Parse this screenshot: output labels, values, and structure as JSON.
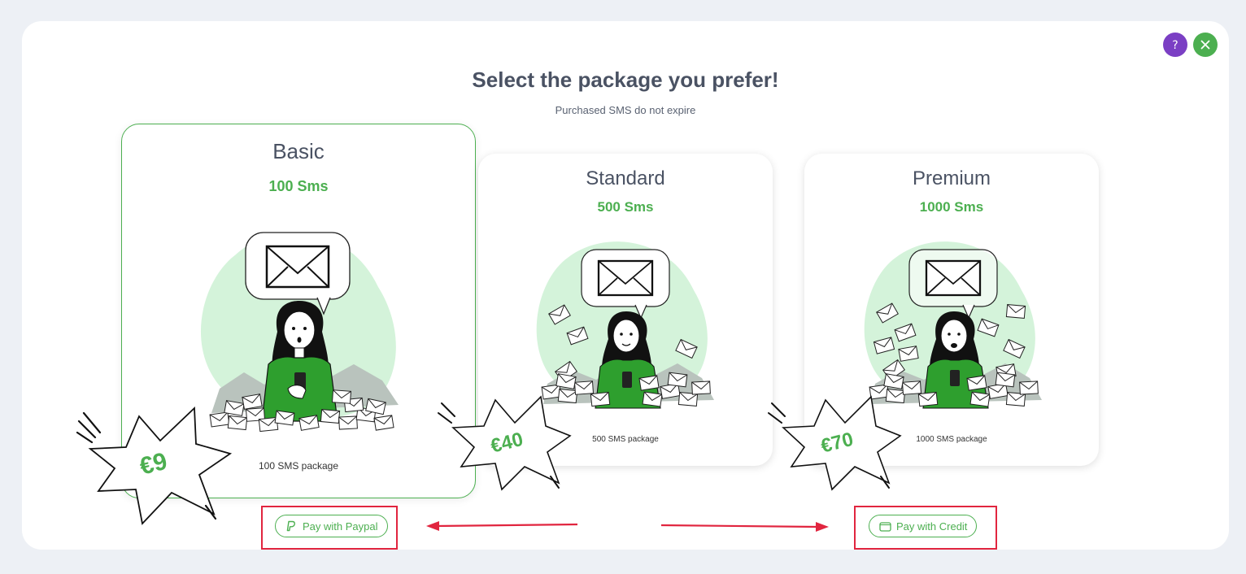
{
  "header": {
    "title": "Select the package you prefer!",
    "subtitle": "Purchased SMS do not expire",
    "help_icon": "question-icon",
    "close_icon": "close-icon"
  },
  "packages": [
    {
      "name": "Basic",
      "sms": "100 Sms",
      "caption": "100 SMS package",
      "price": "€9",
      "selected": true
    },
    {
      "name": "Standard",
      "sms": "500 Sms",
      "caption": "500 SMS package",
      "price": "€40",
      "selected": false
    },
    {
      "name": "Premium",
      "sms": "1000 Sms",
      "caption": "1000 SMS package",
      "price": "€70",
      "selected": false
    }
  ],
  "actions": {
    "paypal_label": "Pay with Paypal",
    "paypal_icon": "paypal-icon",
    "credit_label": "Pay with Credit",
    "credit_icon": "wallet-icon"
  },
  "colors": {
    "accent_green": "#4caf50",
    "help_purple": "#7b3fc4",
    "annotation_red": "#e1253f",
    "title_gray": "#4a5263"
  }
}
